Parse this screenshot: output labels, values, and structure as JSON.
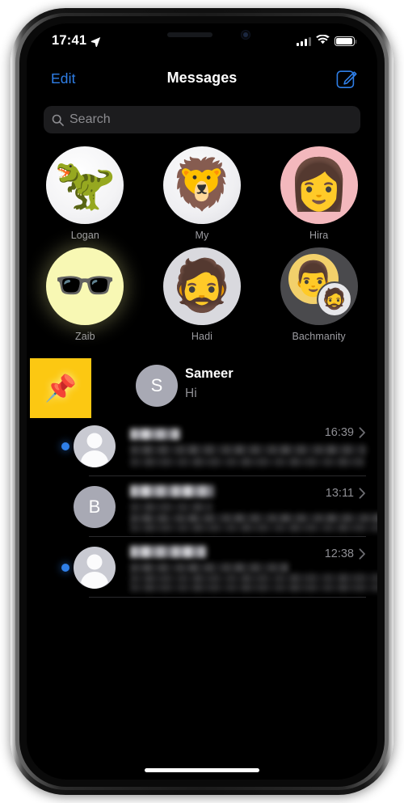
{
  "device": {
    "status_bar": {
      "time": "17:41",
      "location_icon": "location-arrow-icon",
      "cellular_icon": "cellular-bars-icon",
      "wifi_icon": "wifi-icon",
      "battery_icon": "battery-full-icon"
    },
    "home_indicator": "home-indicator"
  },
  "nav": {
    "edit_label": "Edit",
    "title": "Messages",
    "compose_icon": "compose-icon"
  },
  "search": {
    "placeholder": "Search",
    "icon": "search-icon"
  },
  "pinned": [
    {
      "name": "Logan",
      "avatar_style": "av-logan",
      "glyph": "🦖",
      "kind": "single"
    },
    {
      "name": "My",
      "avatar_style": "av-my",
      "glyph": "🦁",
      "kind": "single"
    },
    {
      "name": "Hira",
      "avatar_style": "av-hira",
      "glyph": "👩",
      "kind": "single"
    },
    {
      "name": "Zaib",
      "avatar_style": "av-zaib",
      "glyph": "🕶️",
      "kind": "single"
    },
    {
      "name": "Hadi",
      "avatar_style": "av-hadi",
      "glyph": "🧔",
      "kind": "single"
    },
    {
      "name": "Bachmanity",
      "avatar_style": "av-group",
      "glyph": "👨",
      "glyph_secondary": "🧔",
      "kind": "group"
    }
  ],
  "conversations": [
    {
      "name": "Sameer",
      "preview": "Hi",
      "time": "",
      "unread": false,
      "avatar_initial": "S",
      "swipe_action": {
        "label": "Pin",
        "icon": "pin-icon",
        "color": "#fcc812"
      },
      "redacted": false
    },
    {
      "name": "",
      "preview": "",
      "time": "16:39",
      "unread": true,
      "avatar_initial": "",
      "avatar_icon": "person-placeholder-icon",
      "redacted": true
    },
    {
      "name": "",
      "preview": "",
      "time": "13:11",
      "unread": false,
      "avatar_initial": "B",
      "redacted": true
    },
    {
      "name": "",
      "preview": "",
      "time": "12:38",
      "unread": true,
      "avatar_initial": "",
      "avatar_icon": "person-placeholder-icon",
      "redacted": true
    }
  ],
  "colors": {
    "accent_blue": "#2f7fe8",
    "pin_yellow": "#fcc812",
    "screen_bg": "#000000",
    "secondary_text": "#8e8e93",
    "search_bg": "#1c1c1e"
  }
}
